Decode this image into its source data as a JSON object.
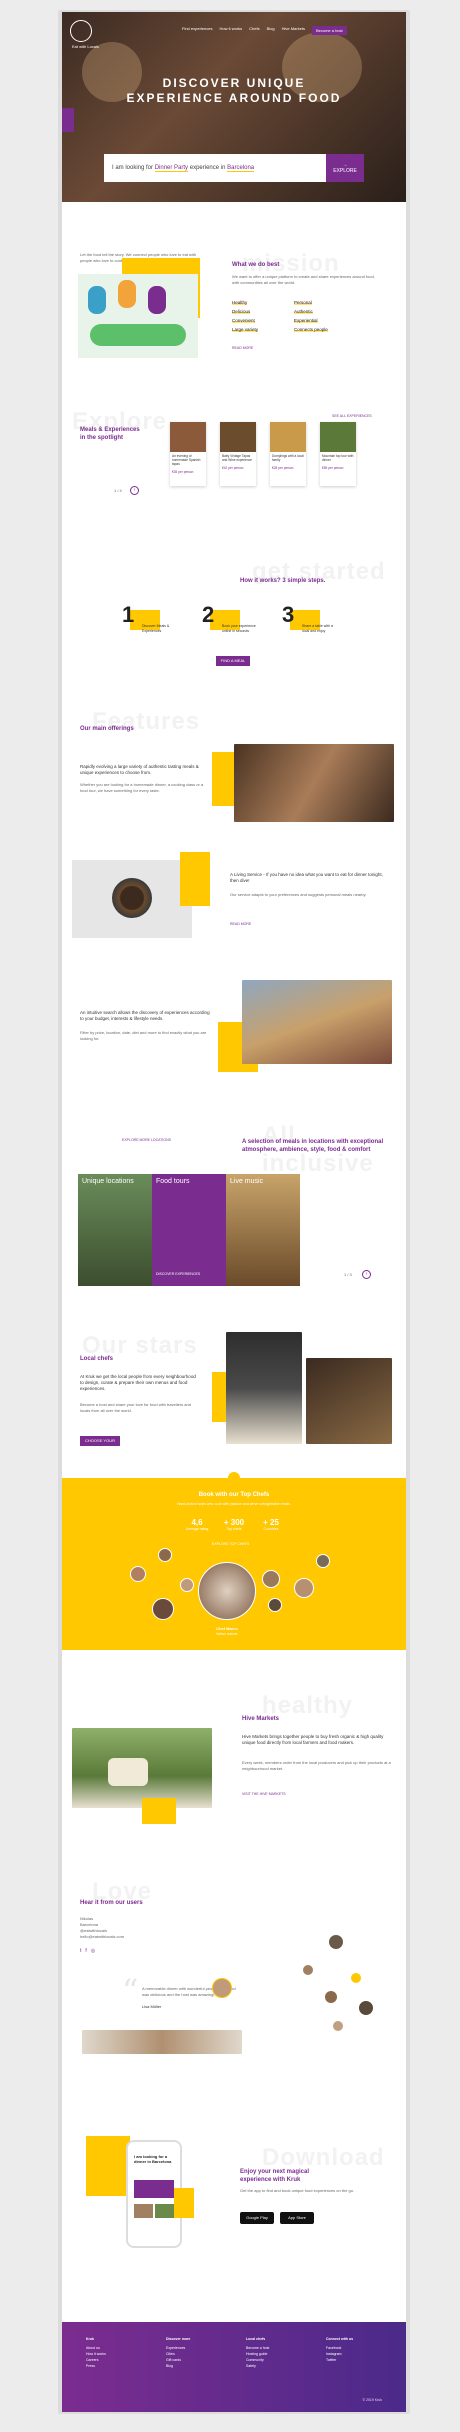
{
  "nav": {
    "items": [
      "Find experiences",
      "How it works",
      "Chefs",
      "Blog",
      "Hive Markets"
    ],
    "cta": "Become a host"
  },
  "logo": {
    "text": "Eat with Locals"
  },
  "hero": {
    "title_line1": "DISCOVER UNIQUE",
    "title_line2": "EXPERIENCE AROUND FOOD",
    "search_prefix": "I am looking for",
    "search_what": "Dinner Party",
    "search_mid": "experience in",
    "search_where": "Barcelona",
    "search_button": "EXPLORE"
  },
  "mission": {
    "ghost": "mission",
    "title": "What we do best",
    "intro": "Let the food tell the story. We connect people who love to eat with people who love to cook.",
    "body": "We want to offer a unique platform to create and share experiences around food, with communities all over the world.",
    "values_left": [
      "Healthy",
      "Delicious",
      "Convenient",
      "Large variety"
    ],
    "values_right": [
      "Personal",
      "Authentic",
      "Experiential",
      "Connects people"
    ],
    "link": "READ MORE"
  },
  "spotlight": {
    "ghost": "Explore",
    "title_line1": "Meals & Experiences",
    "title_line2": "in the spotlight",
    "see_all": "SEE ALL EXPERIENCES",
    "cards": [
      {
        "title": "An evening of homemade Spanish tapas",
        "price": "€35 per person"
      },
      {
        "title": "Baby Vintage Tapas and Wine experience",
        "price": "€42 per person"
      },
      {
        "title": "Dumplings with a local family",
        "price": "€28 per person"
      },
      {
        "title": "Mountain top tour with dinner",
        "price": "€55 per person"
      }
    ],
    "pager": "1 / 4"
  },
  "steps": {
    "ghost": "get started",
    "title": "How it works? 3 simple steps.",
    "items": [
      {
        "n": "1",
        "t": "Discover Meals & Experiences"
      },
      {
        "n": "2",
        "t": "Book your experience online in seconds"
      },
      {
        "n": "3",
        "t": "Share a table with a local and enjoy"
      }
    ],
    "button": "FIND A MEAL"
  },
  "features": {
    "ghost": "Features",
    "title": "Our main offerings",
    "f1_title": "Rapidly evolving a large variety of authentic tasting meals & unique experiences to choose from.",
    "f1_body": "Whether you are looking for a homemade dinner, a cooking class or a food tour, we have something for every taste.",
    "f2_title": "A Living Service - If you have no idea what you want to eat for dinner tonight, then dive!",
    "f2_body": "Our service adapts to your preferences and suggests personal meals nearby.",
    "f2_link": "READ MORE",
    "f3_title": "An intuitive search allows the discovery of experiences according to your budget, interests & lifestyle needs.",
    "f3_body": "Filter by price, location, date, diet and more to find exactly what you are looking for."
  },
  "locations": {
    "ghost": "All inclusive",
    "link": "EXPLORE MORE LOCATIONS",
    "title": "A selection of meals in locations with exceptional atmosphere, ambience, style, food & comfort",
    "tiles": [
      "Unique locations",
      "Food tours",
      "Live music"
    ],
    "tile_link": "DISCOVER EXPERIENCES",
    "pager": "1 / 3"
  },
  "chefs": {
    "ghost": "Our stars",
    "title": "Local chefs",
    "lead": "At Kruk we get the local people from every neighbourhood to design, curate & prepare their own menus and food experiences.",
    "body": "Become a host and share your love for food with travellers and locals from all over the world.",
    "button": "CHOOSE YOUR CHEF"
  },
  "book": {
    "title": "Book with our Top Chefs",
    "subtitle": "Hand-picked hosts who cook with passion and serve unforgettable meals.",
    "stats": [
      {
        "n": "4,6",
        "l": "Average rating"
      },
      {
        "n": "+ 300",
        "l": "Top chefs"
      },
      {
        "n": "+ 25",
        "l": "Countries"
      }
    ],
    "link": "EXPLORE TOP CHEFS",
    "chef_name": "Chef Marco",
    "chef_role": "Italian cuisine"
  },
  "hive": {
    "ghost": "healthy",
    "title": "Hive Markets",
    "lead": "Hive Markets brings together people to buy fresh organic & high quality unique food directly from local farmers and food makers.",
    "body": "Every week, members order from the local producers and pick up their products at a neighbourhood market.",
    "link": "VISIT THE HIVE MARKETS"
  },
  "testimonials": {
    "ghost": "Love",
    "title": "Hear it from our users",
    "contact": [
      "Nikolas",
      "Barcelona",
      "@eatwithlocals",
      "hello@eatwithlocals.com"
    ],
    "quote": "A memorable dinner with wonderful people. The food was delicious and the host was amazing!",
    "author": "Lisa Müller"
  },
  "download": {
    "ghost": "Download",
    "title_line1": "Enjoy your next magical",
    "title_line2": "experience with Kruk",
    "body": "Get the app to find and book unique food experiences on the go.",
    "google": "Google Play",
    "apple": "App Store",
    "phone_title": "I am looking for a dinner in Barcelona"
  },
  "footer": {
    "cols": [
      {
        "title": "Kruk",
        "items": [
          "About us",
          "How it works",
          "Careers",
          "Press"
        ]
      },
      {
        "title": "Discover more",
        "items": [
          "Experiences",
          "Cities",
          "Gift cards",
          "Blog"
        ]
      },
      {
        "title": "Local chefs",
        "items": [
          "Become a host",
          "Hosting guide",
          "Community",
          "Safety"
        ]
      },
      {
        "title": "Connect with us",
        "items": [
          "Facebook",
          "Instagram",
          "Twitter"
        ]
      }
    ],
    "copyright": "© 2019 Kruk"
  }
}
